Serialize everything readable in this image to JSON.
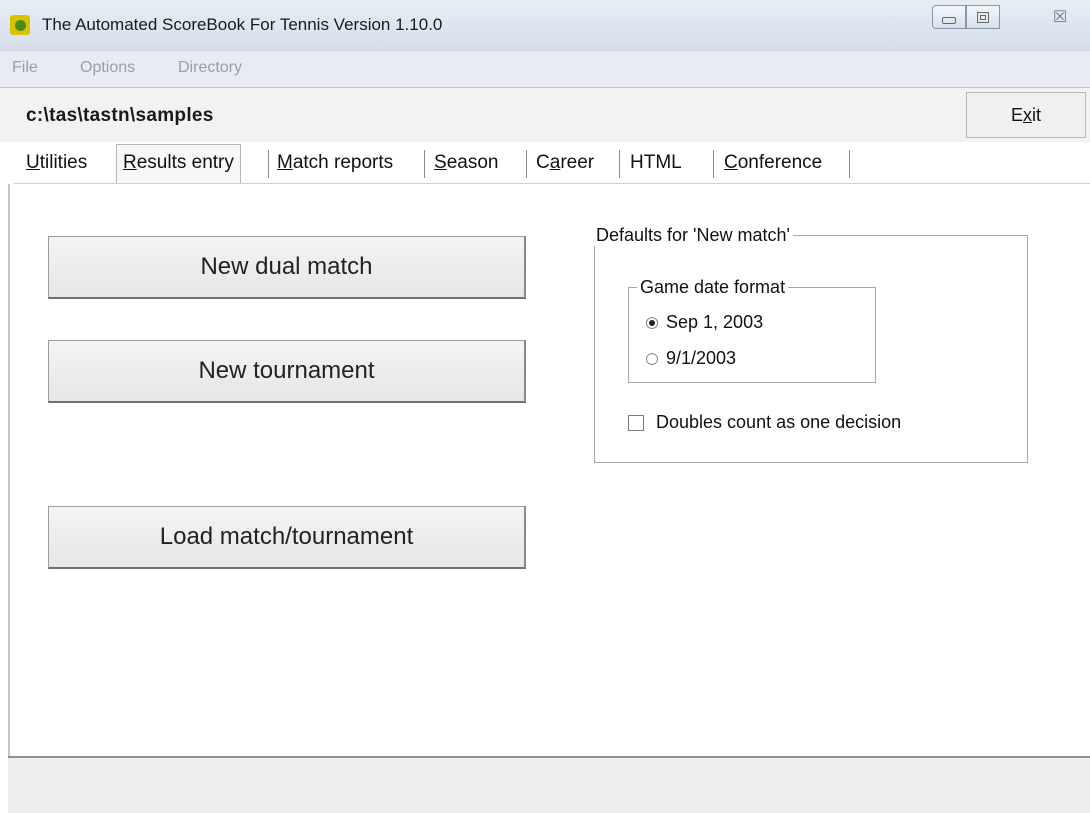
{
  "window": {
    "title": "The Automated ScoreBook For Tennis  Version 1.10.0",
    "controls": {
      "minimize": "",
      "maximize": "",
      "close": "☒"
    }
  },
  "menu": {
    "items": [
      "File",
      "Options",
      "Directory"
    ]
  },
  "path": {
    "text": "c:\\tas\\tastn\\samples"
  },
  "exit_button": {
    "prefix": "E",
    "accel": "x",
    "suffix": "it"
  },
  "tabs": [
    {
      "accel": "U",
      "rest": "tilities"
    },
    {
      "accel": "R",
      "rest": "esults entry"
    },
    {
      "accel": "M",
      "rest": "atch reports"
    },
    {
      "accel": "S",
      "rest": "eason"
    },
    {
      "pre": "C",
      "accel": "a",
      "rest": "reer"
    },
    {
      "label": "HTML"
    },
    {
      "accel": "C",
      "rest": "onference"
    }
  ],
  "buttons": {
    "new_dual_match": "New dual match",
    "new_tournament": "New tournament",
    "load_match": "Load match/tournament"
  },
  "defaults_group": {
    "title": "Defaults for 'New match'",
    "date_format": {
      "title": "Game date format",
      "options": [
        "Sep 1, 2003",
        "9/1/2003"
      ],
      "selected": "Sep 1, 2003"
    },
    "doubles_checkbox": {
      "label": "Doubles count as one decision",
      "checked": false
    }
  }
}
